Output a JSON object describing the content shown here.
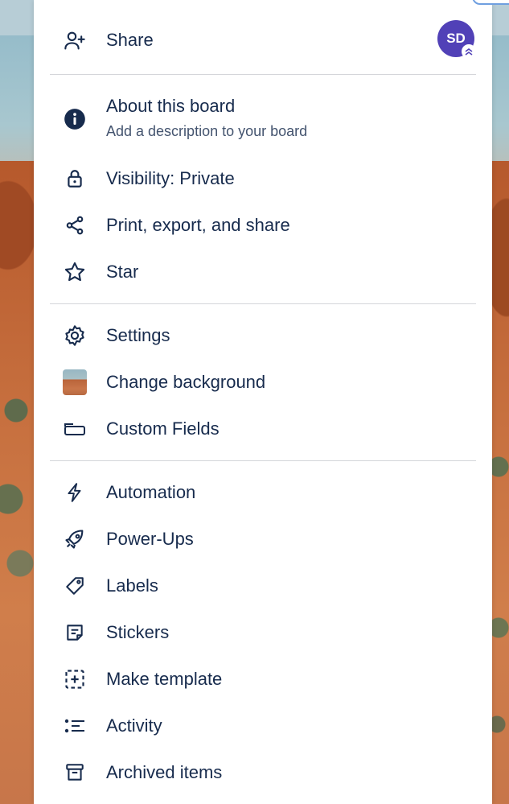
{
  "menu": {
    "share": {
      "label": "Share",
      "icon": "add-person-icon"
    },
    "avatar": {
      "initials": "SD",
      "color": "#5141b7",
      "badge_icon": "chevrons-up-icon"
    },
    "about": {
      "label": "About this board",
      "description": "Add a description to your board",
      "icon": "info-icon"
    },
    "visibility": {
      "label": "Visibility: Private",
      "icon": "lock-icon"
    },
    "print": {
      "label": "Print, export, and share",
      "icon": "share-nodes-icon"
    },
    "star": {
      "label": "Star",
      "icon": "star-icon"
    },
    "settings": {
      "label": "Settings",
      "icon": "gear-icon"
    },
    "background": {
      "label": "Change background",
      "icon": "background-thumbnail"
    },
    "custom_fields": {
      "label": "Custom Fields",
      "icon": "custom-fields-icon"
    },
    "automation": {
      "label": "Automation",
      "icon": "lightning-icon"
    },
    "powerups": {
      "label": "Power-Ups",
      "icon": "rocket-icon"
    },
    "labels": {
      "label": "Labels",
      "icon": "tag-icon"
    },
    "stickers": {
      "label": "Stickers",
      "icon": "sticker-icon"
    },
    "template": {
      "label": "Make template",
      "icon": "template-icon"
    },
    "activity": {
      "label": "Activity",
      "icon": "list-icon"
    },
    "archived": {
      "label": "Archived items",
      "icon": "archive-icon"
    }
  }
}
